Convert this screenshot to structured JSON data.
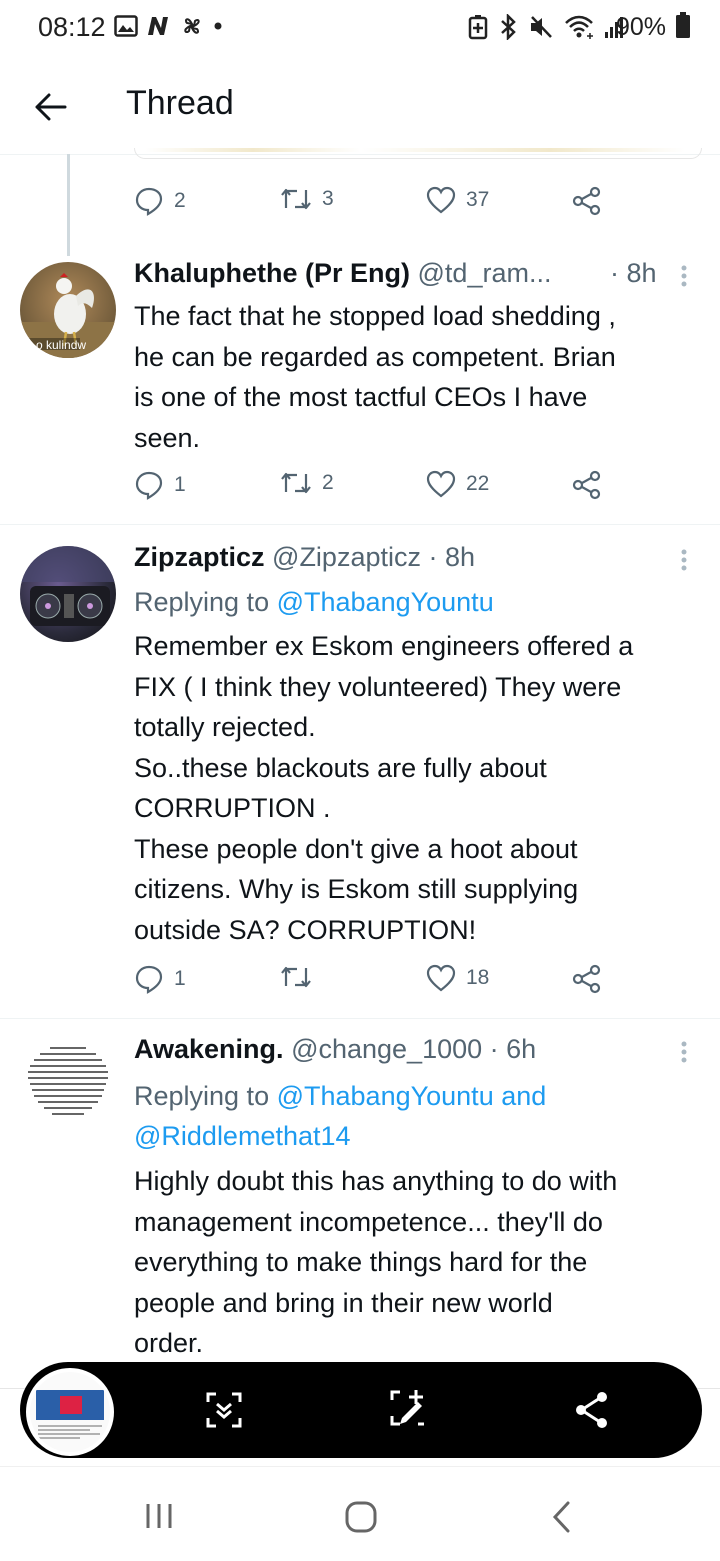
{
  "status_bar": {
    "time": "08:12",
    "battery": "90%",
    "left_icons": [
      "image-icon",
      "n-icon",
      "pinwheel-icon",
      "dot-icon"
    ],
    "right_icons": [
      "battery-saver-icon",
      "bluetooth-icon",
      "mute-icon",
      "wifi-icon",
      "signal-icon",
      "battery-icon"
    ]
  },
  "header": {
    "title": "Thread"
  },
  "top_tweet_actions": {
    "replies": "2",
    "retweets": "3",
    "likes": "37"
  },
  "tweets": [
    {
      "name": "Khaluphethe (Pr Eng)",
      "handle": "@td_ram...",
      "time": "· 8h",
      "avatar_text": "o kulindw",
      "text": "The fact that he stopped load shedding ,\nhe can be regarded as competent. Brian\nis one of the most tactful CEOs I have\nseen.",
      "replies": "1",
      "retweets": "2",
      "likes": "22"
    },
    {
      "name": "Zipzapticz",
      "handle": "@Zipzapticz",
      "time": "· 8h",
      "replying_prefix": "Replying to",
      "replying_to": "@ThabangYountu",
      "text": "Remember ex Eskom engineers offered a\nFIX ( I think they volunteered) They were\ntotally rejected.\nSo..these blackouts are fully about\nCORRUPTION .\nThese people don't give a hoot about\ncitizens. Why is Eskom still supplying\noutside SA? CORRUPTION!",
      "replies": "1",
      "retweets": "",
      "likes": "18"
    },
    {
      "name": "Awakening.",
      "handle": "@change_1000",
      "time": "· 6h",
      "replying_prefix": "Replying to",
      "replying_to": "@ThabangYountu and",
      "replying_to_2": "@Riddlemethat14",
      "text": "Highly doubt this has anything to do with\nmanagement incompetence... they'll do\neverything to make things hard for the\npeople and bring in their new world\norder."
    }
  ],
  "capture_toolbar": {
    "icons": [
      "scroll-capture-icon",
      "edit-capture-icon",
      "share-icon"
    ]
  },
  "nav_bar": {
    "icons": [
      "recent-apps-icon",
      "home-icon",
      "back-icon"
    ]
  }
}
